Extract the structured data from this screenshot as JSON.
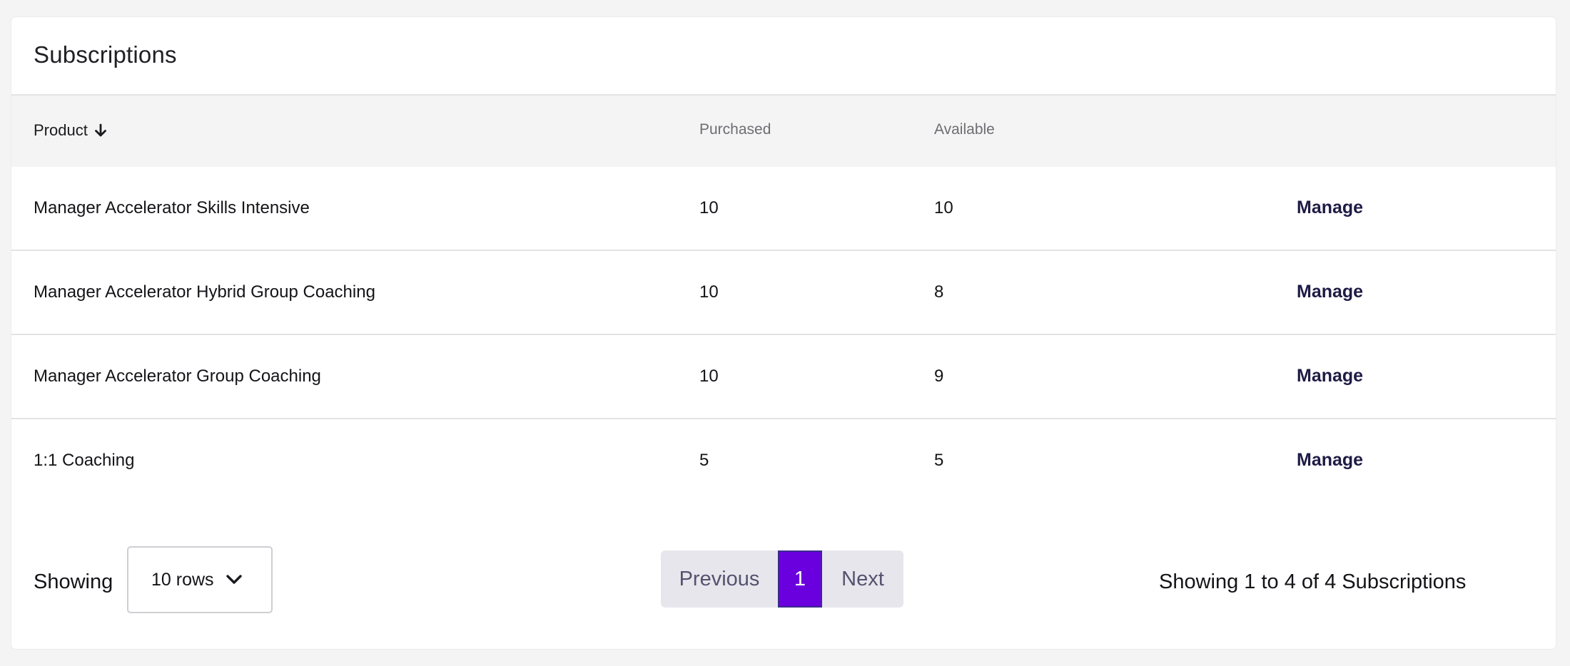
{
  "card": {
    "title": "Subscriptions"
  },
  "table": {
    "columns": {
      "product": "Product",
      "purchased": "Purchased",
      "available": "Available"
    },
    "sort_icon": "arrow-down-icon",
    "rows": [
      {
        "product": "Manager Accelerator Skills Intensive",
        "purchased": "10",
        "available": "10",
        "action": "Manage"
      },
      {
        "product": "Manager Accelerator Hybrid Group Coaching",
        "purchased": "10",
        "available": "8",
        "action": "Manage"
      },
      {
        "product": "Manager Accelerator Group Coaching",
        "purchased": "10",
        "available": "9",
        "action": "Manage"
      },
      {
        "product": "1:1 Coaching",
        "purchased": "5",
        "available": "5",
        "action": "Manage"
      }
    ]
  },
  "footer": {
    "showing_label": "Showing",
    "rows_select": {
      "value": "10 rows",
      "icon": "chevron-down-icon"
    },
    "pagination": {
      "previous": "Previous",
      "current_page": "1",
      "next": "Next"
    },
    "summary": "Showing 1 to 4 of 4 Subscriptions"
  },
  "colors": {
    "accent": "#6b00de",
    "link": "#1e1b45",
    "header_bg": "#f4f4f4",
    "pagination_bg": "#e7e6ec"
  }
}
